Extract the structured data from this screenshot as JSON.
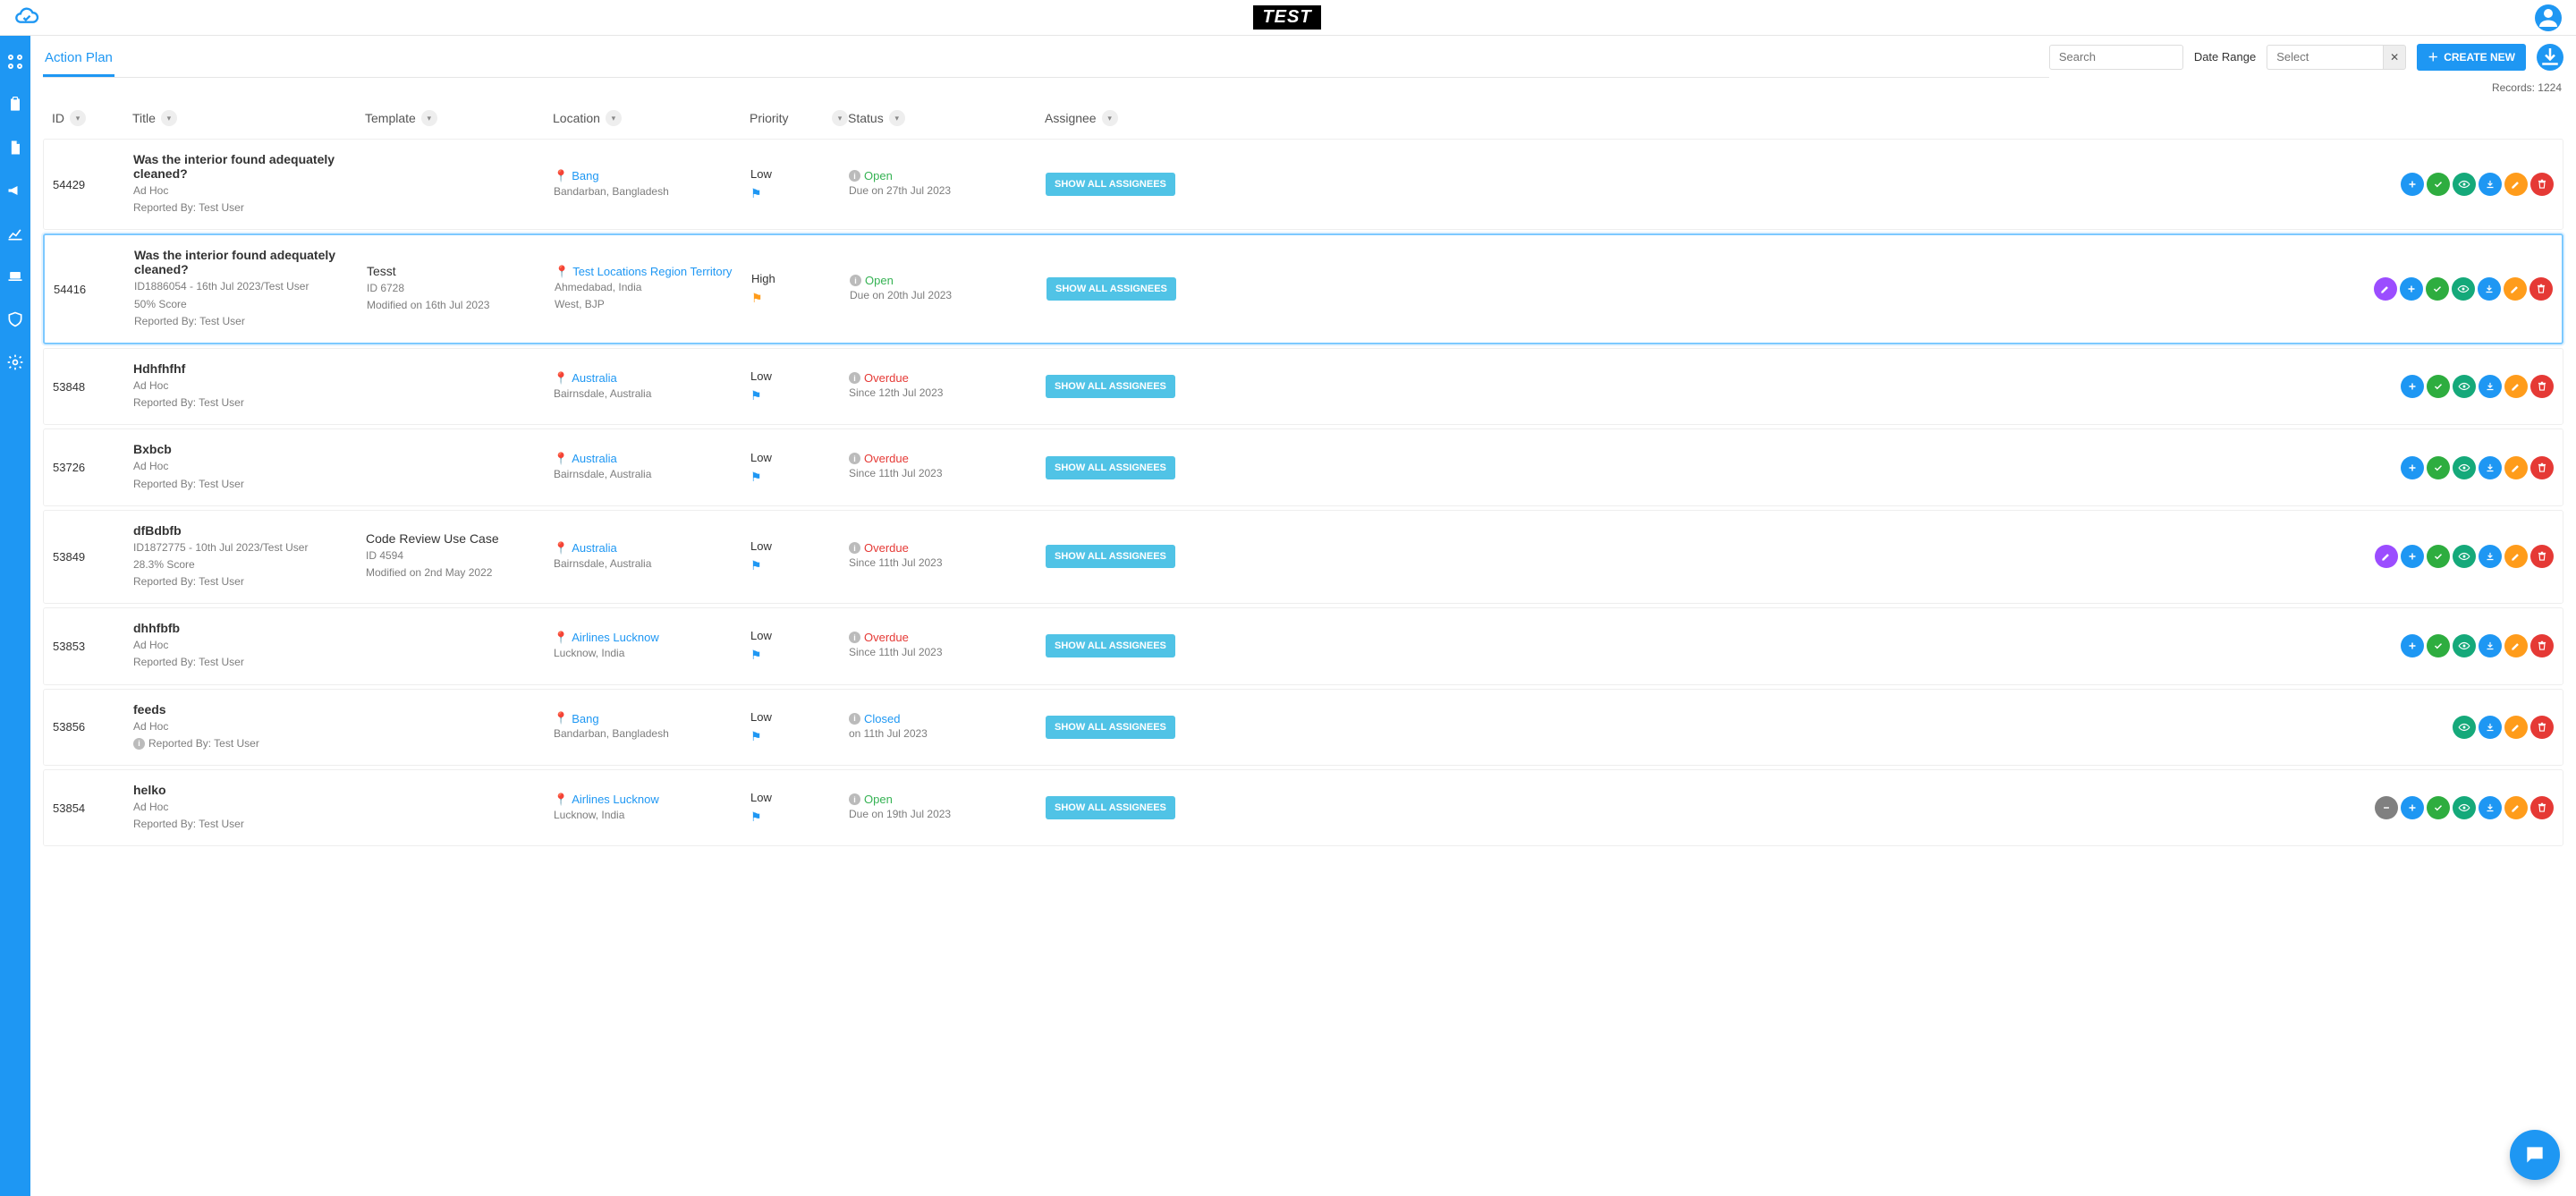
{
  "header": {
    "logo_text": "TEST",
    "page_title": "Action Plan",
    "search_placeholder": "Search",
    "date_range_label": "Date Range",
    "date_range_placeholder": "Select",
    "create_label": "CREATE NEW",
    "records_label": "Records: 1224"
  },
  "columns": [
    "ID",
    "Title",
    "Template",
    "Location",
    "Priority",
    "Status",
    "Assignee"
  ],
  "assignee_btn": "SHOW ALL ASSIGNEES",
  "rows": [
    {
      "selected": false,
      "id": "54429",
      "title": "Was the interior found adequately cleaned?",
      "lines": [
        "Ad Hoc",
        "Reported By: Test User"
      ],
      "template": null,
      "loc_name": "Bang",
      "loc_lines": [
        "Bandarban, Bangladesh"
      ],
      "priority": "Low",
      "prio_class": "low",
      "status": "Open",
      "status_class": "st-open",
      "status_sub": "Due on 27th Jul 2023",
      "actions": [
        "add",
        "check",
        "eye",
        "download",
        "pencil",
        "trash"
      ]
    },
    {
      "selected": true,
      "id": "54416",
      "title": "Was the interior found adequately cleaned?",
      "lines": [
        "ID1886054 - 16th Jul 2023/Test User",
        "50% Score",
        "Reported By: Test User"
      ],
      "template": {
        "name": "Tesst",
        "id": "ID 6728",
        "mod": "Modified on 16th Jul 2023"
      },
      "loc_name": "Test Locations Region Territory",
      "loc_lines": [
        "Ahmedabad, India",
        "West, BJP"
      ],
      "priority": "High",
      "prio_class": "high",
      "status": "Open",
      "status_class": "st-open",
      "status_sub": "Due on 20th Jul 2023",
      "actions": [
        "pencil-p",
        "add",
        "check",
        "eye",
        "download",
        "pencil",
        "trash"
      ]
    },
    {
      "selected": false,
      "id": "53848",
      "title": "Hdhfhfhf",
      "lines": [
        "Ad Hoc",
        "Reported By: Test User"
      ],
      "template": null,
      "loc_name": "Australia",
      "loc_lines": [
        "Bairnsdale, Australia"
      ],
      "priority": "Low",
      "prio_class": "low",
      "status": "Overdue",
      "status_class": "st-overdue",
      "status_sub": "Since 12th Jul 2023",
      "actions": [
        "add",
        "check",
        "eye",
        "download",
        "pencil",
        "trash"
      ]
    },
    {
      "selected": false,
      "id": "53726",
      "title": "Bxbcb",
      "lines": [
        "Ad Hoc",
        "Reported By: Test User"
      ],
      "template": null,
      "loc_name": "Australia",
      "loc_lines": [
        "Bairnsdale, Australia"
      ],
      "priority": "Low",
      "prio_class": "low",
      "status": "Overdue",
      "status_class": "st-overdue",
      "status_sub": "Since 11th Jul 2023",
      "actions": [
        "add",
        "check",
        "eye",
        "download",
        "pencil",
        "trash"
      ]
    },
    {
      "selected": false,
      "id": "53849",
      "title": "dfBdbfb",
      "lines": [
        "ID1872775 - 10th Jul 2023/Test User",
        "28.3% Score",
        "Reported By: Test User"
      ],
      "template": {
        "name": "Code Review Use Case",
        "id": "ID 4594",
        "mod": "Modified on 2nd May 2022"
      },
      "loc_name": "Australia",
      "loc_lines": [
        "Bairnsdale, Australia"
      ],
      "priority": "Low",
      "prio_class": "low",
      "status": "Overdue",
      "status_class": "st-overdue",
      "status_sub": "Since 11th Jul 2023",
      "actions": [
        "pencil-p",
        "add",
        "check",
        "eye",
        "download",
        "pencil",
        "trash"
      ]
    },
    {
      "selected": false,
      "id": "53853",
      "title": "dhhfbfb",
      "lines": [
        "Ad Hoc",
        "Reported By: Test User"
      ],
      "template": null,
      "loc_name": "Airlines Lucknow",
      "loc_lines": [
        "Lucknow, India"
      ],
      "priority": "Low",
      "prio_class": "low",
      "status": "Overdue",
      "status_class": "st-overdue",
      "status_sub": "Since 11th Jul 2023",
      "actions": [
        "add",
        "check",
        "eye",
        "download",
        "pencil",
        "trash"
      ]
    },
    {
      "selected": false,
      "id": "53856",
      "title": "feeds",
      "lines": [
        "Ad Hoc"
      ],
      "reported_with_icon": "Reported By: Test User",
      "template": null,
      "loc_name": "Bang",
      "loc_lines": [
        "Bandarban, Bangladesh"
      ],
      "priority": "Low",
      "prio_class": "low",
      "status": "Closed",
      "status_class": "st-closed",
      "status_sub": "on 11th Jul 2023",
      "actions": [
        "eye",
        "download",
        "pencil",
        "trash"
      ]
    },
    {
      "selected": false,
      "id": "53854",
      "title": "helko",
      "lines": [
        "Ad Hoc",
        "Reported By: Test User"
      ],
      "template": null,
      "loc_name": "Airlines Lucknow",
      "loc_lines": [
        "Lucknow, India"
      ],
      "priority": "Low",
      "prio_class": "low",
      "status": "Open",
      "status_class": "st-open",
      "status_sub": "Due on 19th Jul 2023",
      "actions": [
        "neutral",
        "add",
        "check",
        "eye",
        "download",
        "pencil",
        "trash"
      ]
    }
  ]
}
